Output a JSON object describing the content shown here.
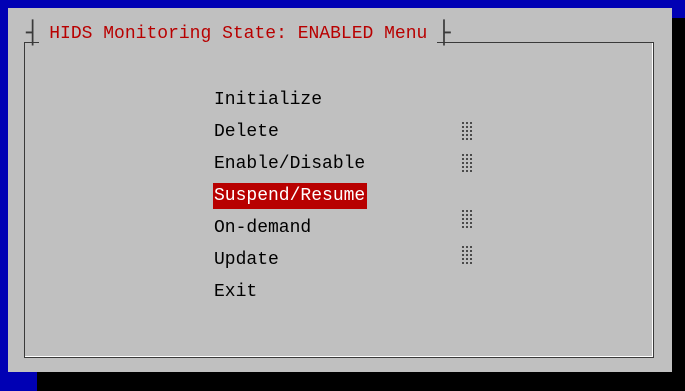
{
  "dialog": {
    "title": "HIDS Monitoring State: ENABLED Menu"
  },
  "menu": {
    "items": [
      {
        "label": "Initialize",
        "selected": false
      },
      {
        "label": "Delete",
        "selected": false
      },
      {
        "label": "Enable/Disable",
        "selected": false
      },
      {
        "label": "Suspend/Resume",
        "selected": true
      },
      {
        "label": "On-demand",
        "selected": false
      },
      {
        "label": "Update",
        "selected": false
      },
      {
        "label": "Exit",
        "selected": false
      }
    ]
  },
  "colors": {
    "background": "#0000b4",
    "dialog": "#c0c0c0",
    "title_text": "#b80000",
    "highlight": "#b80000",
    "highlight_text": "#ffffff",
    "shadow": "#000000"
  }
}
